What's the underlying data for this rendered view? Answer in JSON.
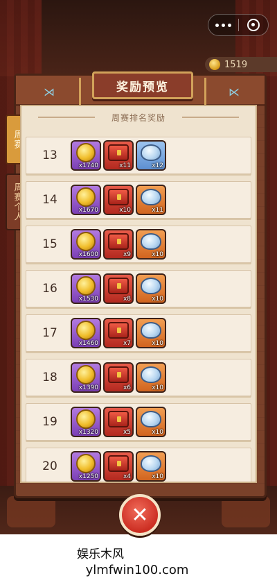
{
  "top_bar": {
    "more_icon": "more-dots-icon",
    "close_icon": "target-close-icon",
    "score": "1519"
  },
  "panel": {
    "title": "奖励预览",
    "subtitle": "周赛排名奖励"
  },
  "tabs": [
    {
      "label": "周赛",
      "active": true
    },
    {
      "label": "周赛个人",
      "active": false
    }
  ],
  "rows": [
    {
      "rank": "13",
      "items": [
        {
          "icon": "coin-icon",
          "color": "purple",
          "qty": "x1740"
        },
        {
          "icon": "chest-icon",
          "color": "red",
          "qty": "x11"
        },
        {
          "icon": "bowl-icon",
          "color": "blue",
          "qty": "x12"
        }
      ]
    },
    {
      "rank": "14",
      "items": [
        {
          "icon": "coin-icon",
          "color": "purple",
          "qty": "x1670"
        },
        {
          "icon": "chest-icon",
          "color": "red",
          "qty": "x10"
        },
        {
          "icon": "bowl-icon",
          "color": "orange",
          "qty": "x11"
        }
      ]
    },
    {
      "rank": "15",
      "items": [
        {
          "icon": "coin-icon",
          "color": "purple",
          "qty": "x1600"
        },
        {
          "icon": "chest-icon",
          "color": "red",
          "qty": "x9"
        },
        {
          "icon": "bowl-icon",
          "color": "orange",
          "qty": "x10"
        }
      ]
    },
    {
      "rank": "16",
      "items": [
        {
          "icon": "coin-icon",
          "color": "purple",
          "qty": "x1530"
        },
        {
          "icon": "chest-icon",
          "color": "red",
          "qty": "x8"
        },
        {
          "icon": "bowl-icon",
          "color": "orange",
          "qty": "x10"
        }
      ]
    },
    {
      "rank": "17",
      "items": [
        {
          "icon": "coin-icon",
          "color": "purple",
          "qty": "x1460"
        },
        {
          "icon": "chest-icon",
          "color": "red",
          "qty": "x7"
        },
        {
          "icon": "bowl-icon",
          "color": "orange",
          "qty": "x10"
        }
      ]
    },
    {
      "rank": "18",
      "items": [
        {
          "icon": "coin-icon",
          "color": "purple",
          "qty": "x1390"
        },
        {
          "icon": "chest-icon",
          "color": "red",
          "qty": "x6"
        },
        {
          "icon": "bowl-icon",
          "color": "orange",
          "qty": "x10"
        }
      ]
    },
    {
      "rank": "19",
      "items": [
        {
          "icon": "coin-icon",
          "color": "purple",
          "qty": "x1320"
        },
        {
          "icon": "chest-icon",
          "color": "red",
          "qty": "x5"
        },
        {
          "icon": "bowl-icon",
          "color": "orange",
          "qty": "x10"
        }
      ]
    },
    {
      "rank": "20",
      "items": [
        {
          "icon": "coin-icon",
          "color": "purple",
          "qty": "x1250"
        },
        {
          "icon": "chest-icon",
          "color": "red",
          "qty": "x4"
        },
        {
          "icon": "bowl-icon",
          "color": "orange",
          "qty": "x10"
        }
      ]
    }
  ],
  "close_button": {
    "icon": "close-x-icon",
    "label": "✕"
  },
  "watermark": {
    "brand": "娱乐木风",
    "url": "ylmfwin100.com"
  }
}
